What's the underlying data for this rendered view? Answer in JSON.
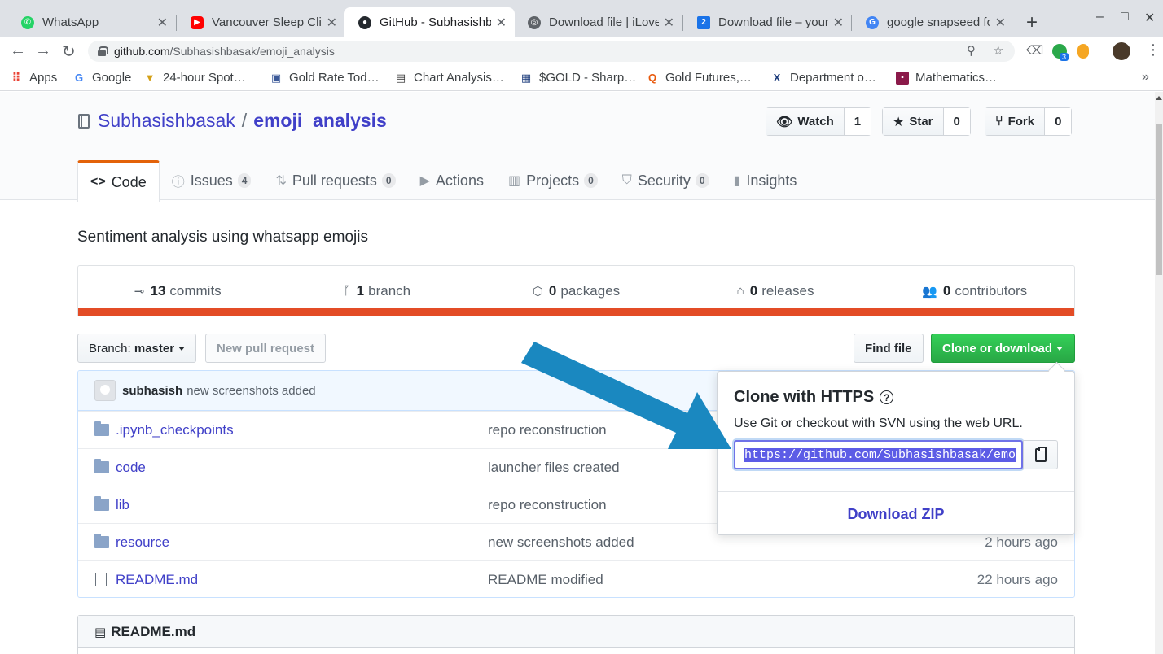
{
  "browser": {
    "tabs": [
      {
        "title": "WhatsApp",
        "favicon": "whatsapp-icon",
        "color": "#25d366"
      },
      {
        "title": "Vancouver Sleep Clin",
        "favicon": "youtube-icon",
        "color": "#ff0000"
      },
      {
        "title": "GitHub - Subhasishba",
        "favicon": "github-icon",
        "color": "#24292e",
        "active": true
      },
      {
        "title": "Download file | iLove",
        "favicon": "globe-icon",
        "color": "#5f6368"
      },
      {
        "title": "Download file – your",
        "favicon": "doc-2-icon",
        "color": "#1a73e8"
      },
      {
        "title": "google snapseed for",
        "favicon": "google-icon",
        "color": "#4285f4"
      }
    ],
    "new_tab": "+",
    "window_controls": {
      "minimize": "–",
      "maximize": "□",
      "close": "✕"
    },
    "url_host": "github.com",
    "url_path": "/Subhasishbasak/emoji_analysis",
    "extension_badge": "3",
    "bookmarks": [
      {
        "label": "Apps",
        "icon": "apps-grid-icon"
      },
      {
        "label": "Google",
        "icon": "google-icon"
      },
      {
        "label": "24-hour Spot…",
        "icon": "gold-icon"
      },
      {
        "label": "Gold Rate Tod…",
        "icon": "chart-icon"
      },
      {
        "label": "Chart Analysis…",
        "icon": "chart-icon"
      },
      {
        "label": "$GOLD - Sharp…",
        "icon": "stock-icon"
      },
      {
        "label": "Gold Futures,…",
        "icon": "q-icon"
      },
      {
        "label": "Department o…",
        "icon": "x-icon"
      },
      {
        "label": "Mathematics…",
        "icon": "book-icon"
      }
    ],
    "bookmarks_more": "»"
  },
  "repo": {
    "owner": "Subhasishbasak",
    "separator": "/",
    "name": "emoji_analysis",
    "watch_label": "Watch",
    "watch_count": "1",
    "star_label": "Star",
    "star_count": "0",
    "fork_label": "Fork",
    "fork_count": "0"
  },
  "reponav": [
    {
      "label": "Code",
      "icon": "code-icon",
      "selected": true
    },
    {
      "label": "Issues",
      "icon": "issue-icon",
      "count": "4"
    },
    {
      "label": "Pull requests",
      "icon": "pull-request-icon",
      "count": "0"
    },
    {
      "label": "Actions",
      "icon": "play-icon"
    },
    {
      "label": "Projects",
      "icon": "project-icon",
      "count": "0"
    },
    {
      "label": "Security",
      "icon": "shield-icon",
      "count": "0"
    },
    {
      "label": "Insights",
      "icon": "graph-icon"
    }
  ],
  "description": "Sentiment analysis using whatsapp emojis",
  "summary": [
    {
      "num": "13",
      "label": "commits",
      "icon": "commit-icon"
    },
    {
      "num": "1",
      "label": "branch",
      "icon": "branch-icon"
    },
    {
      "num": "0",
      "label": "packages",
      "icon": "package-icon"
    },
    {
      "num": "0",
      "label": "releases",
      "icon": "tag-icon"
    },
    {
      "num": "0",
      "label": "contributors",
      "icon": "people-icon"
    }
  ],
  "language_color": "#e34c26",
  "filenav": {
    "branch_prefix": "Branch:",
    "branch_name": "master",
    "new_pr": "New pull request",
    "find_file": "Find file",
    "clone_download": "Clone or download"
  },
  "latest_commit": {
    "author": "subhasish",
    "message": "new screenshots added"
  },
  "files": [
    {
      "name": ".ipynb_checkpoints",
      "type": "folder",
      "message": "repo reconstruction",
      "age": ""
    },
    {
      "name": "code",
      "type": "folder",
      "message": "launcher files created",
      "age": ""
    },
    {
      "name": "lib",
      "type": "folder",
      "message": "repo reconstruction",
      "age": ""
    },
    {
      "name": "resource",
      "type": "folder",
      "message": "new screenshots added",
      "age": "2 hours ago"
    },
    {
      "name": "README.md",
      "type": "file",
      "message": "README modified",
      "age": "22 hours ago"
    }
  ],
  "readme_title": "README.md",
  "clone": {
    "title": "Clone with HTTPS",
    "help": "?",
    "description": "Use Git or checkout with SVN using the web URL.",
    "url": "https://github.com/Subhasishbasak/emo",
    "download_zip": "Download ZIP"
  },
  "annotation_arrow_color": "#1a88c0"
}
